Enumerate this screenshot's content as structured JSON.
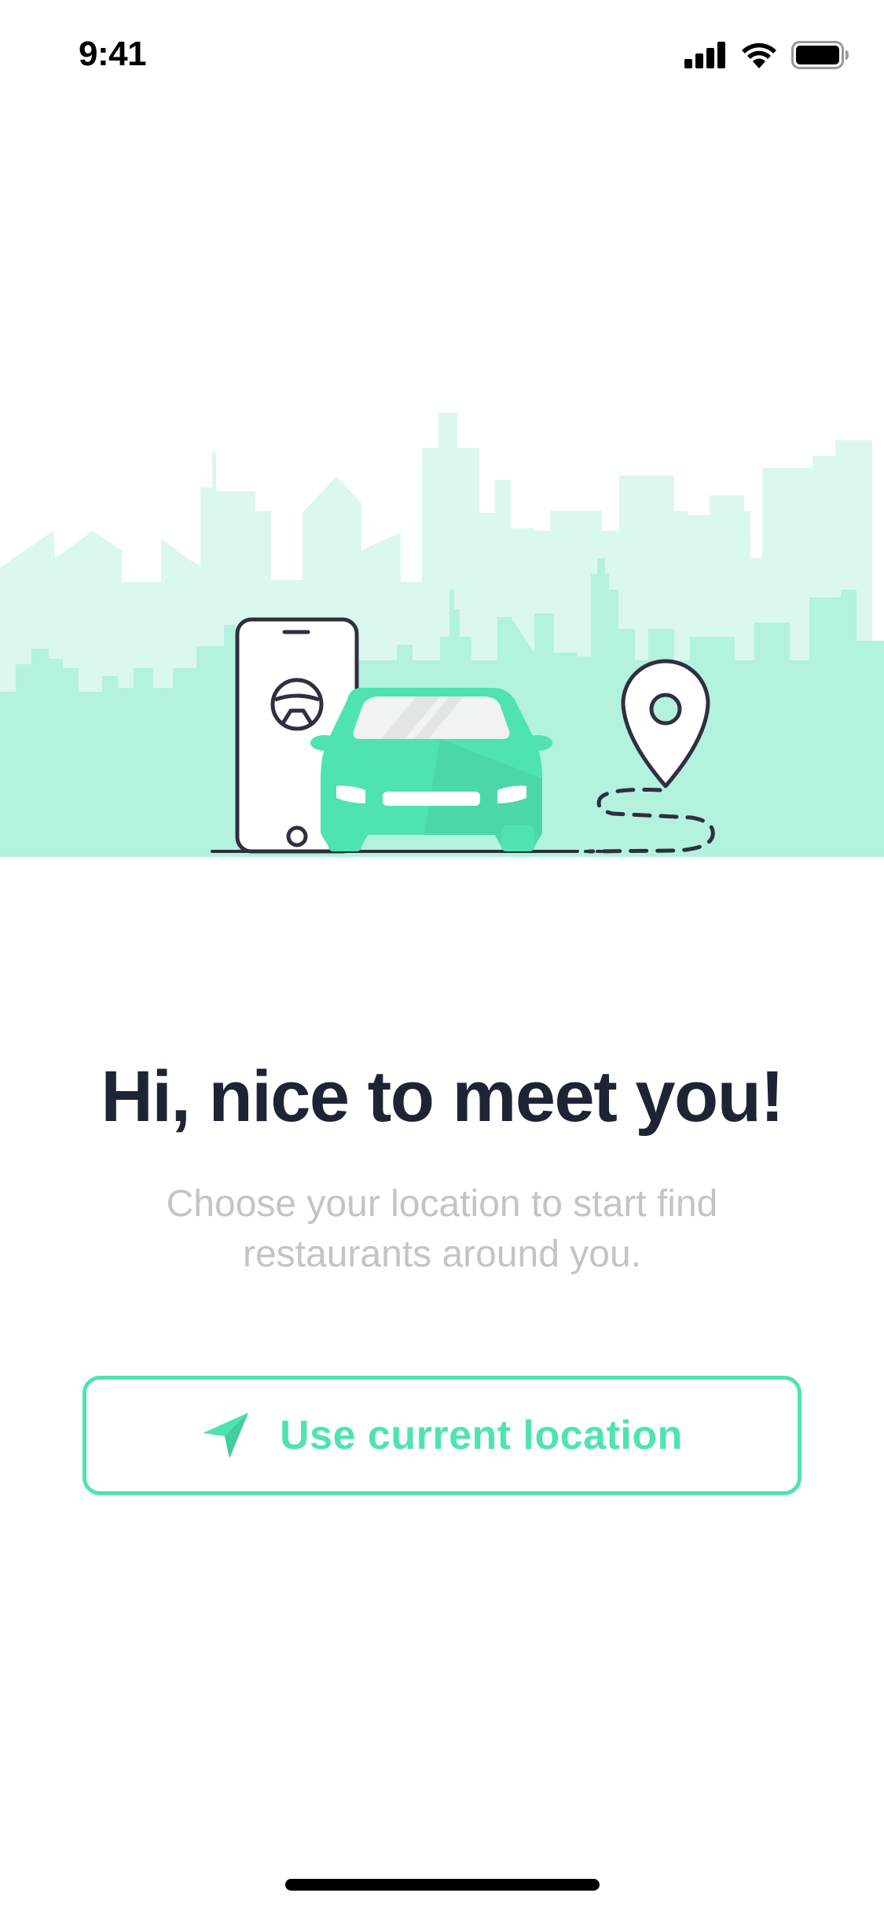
{
  "status_bar": {
    "time": "9:41",
    "icons": [
      "cellular-signal-icon",
      "wifi-icon",
      "battery-icon"
    ]
  },
  "illustration": {
    "description_icons": [
      "city-skyline",
      "phone-with-steering-wheel-icon",
      "car-icon",
      "map-pin-icon",
      "dashed-route"
    ]
  },
  "onboarding": {
    "headline": "Hi, nice to meet you!",
    "subtitle": "Choose your location to start find restaurants around you.",
    "button_label": "Use current location",
    "button_icon": "navigation-arrow-icon"
  },
  "colors": {
    "accent": "#4fe3b0",
    "headline": "#1e2434",
    "subtitle": "#c4c4c7",
    "skyline_light": "#dbf8ee",
    "skyline_mid": "#b3f2dc",
    "car": "#4fe3b0",
    "outline": "#2f2f3f"
  }
}
